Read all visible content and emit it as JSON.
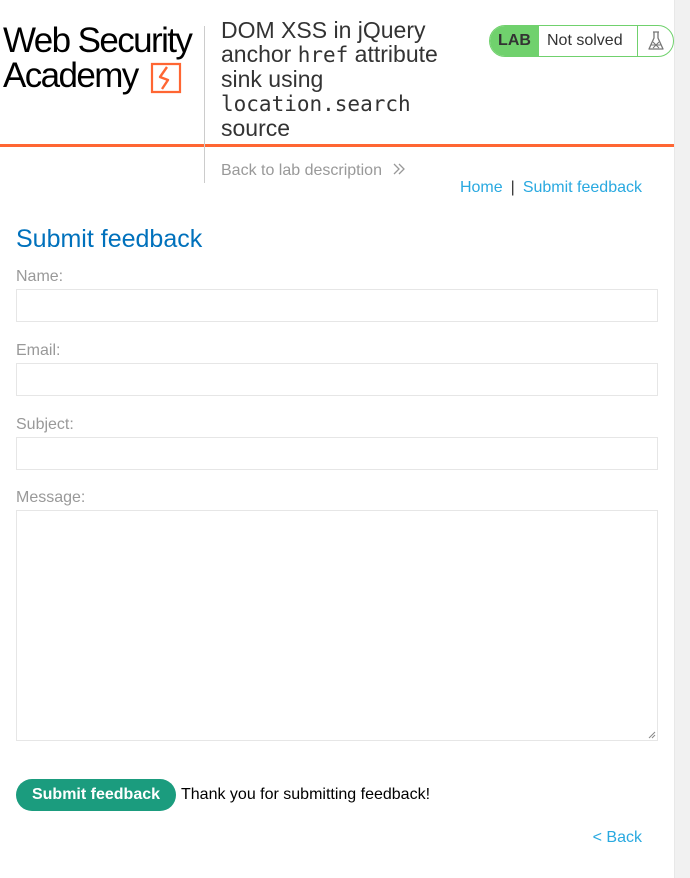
{
  "logo": {
    "line1": "Web Security",
    "line2": "Academy"
  },
  "lab": {
    "title_pre": "DOM XSS in jQuery anchor ",
    "title_code1": "href",
    "title_mid": " attribute sink using ",
    "title_code2": "location.search",
    "title_post": " source",
    "badge": "LAB",
    "status": "Not solved",
    "back_link": "Back to lab description"
  },
  "nav": {
    "home": "Home",
    "separator": "|",
    "submit_feedback": "Submit feedback"
  },
  "form": {
    "heading": "Submit feedback",
    "name_label": "Name:",
    "email_label": "Email:",
    "subject_label": "Subject:",
    "message_label": "Message:",
    "submit_label": "Submit feedback",
    "confirmation": "Thank you for submitting feedback!",
    "back_link": "< Back"
  },
  "colors": {
    "accent_orange": "#ff6633",
    "solved_green": "#70d16d",
    "link_blue": "#29a9e0",
    "heading_blue": "#0071bc",
    "button_teal": "#1b9c7e"
  }
}
